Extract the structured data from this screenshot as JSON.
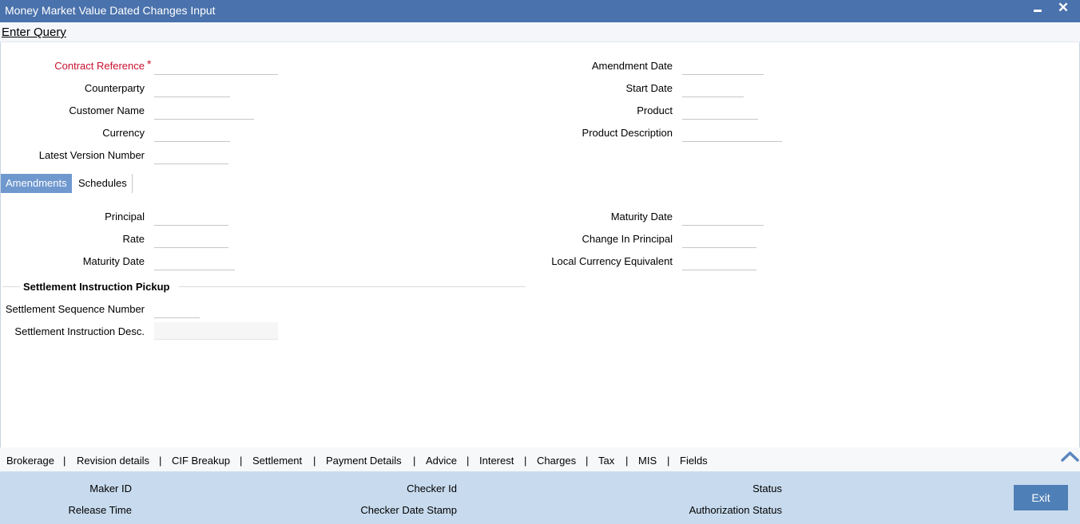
{
  "window": {
    "title": "Money Market Value Dated Changes Input"
  },
  "toolbar": {
    "enter_query": "Enter Query"
  },
  "header_fields": {
    "contract_reference": {
      "label": "Contract Reference",
      "required_mark": "*",
      "value": ""
    },
    "counterparty": {
      "label": "Counterparty",
      "value": ""
    },
    "customer_name": {
      "label": "Customer Name",
      "value": ""
    },
    "currency": {
      "label": "Currency",
      "value": ""
    },
    "latest_version_number": {
      "label": "Latest Version Number",
      "value": ""
    },
    "amendment_date": {
      "label": "Amendment Date",
      "value": ""
    },
    "start_date": {
      "label": "Start Date",
      "value": ""
    },
    "product": {
      "label": "Product",
      "value": ""
    },
    "product_description": {
      "label": "Product Description",
      "value": ""
    }
  },
  "tabs": [
    {
      "label": "Amendments",
      "active": true
    },
    {
      "label": "Schedules",
      "active": false
    }
  ],
  "amendments": {
    "principal": {
      "label": "Principal",
      "value": ""
    },
    "rate": {
      "label": "Rate",
      "value": ""
    },
    "maturity_date_left": {
      "label": "Maturity Date",
      "value": ""
    },
    "maturity_date_right": {
      "label": "Maturity Date",
      "value": ""
    },
    "change_in_principal": {
      "label": "Change In Principal",
      "value": ""
    },
    "local_currency_equivalent": {
      "label": "Local Currency Equivalent",
      "value": ""
    }
  },
  "settlement": {
    "section_title": "Settlement Instruction Pickup",
    "sequence_number": {
      "label": "Settlement Sequence Number",
      "value": ""
    },
    "instruction_desc": {
      "label": "Settlement Instruction Desc.",
      "value": ""
    }
  },
  "footer_links": [
    "Brokerage",
    "Revision details",
    "CIF Breakup",
    "Settlement",
    "Payment Details",
    "Advice",
    "Interest",
    "Charges",
    "Tax",
    "MIS",
    "Fields"
  ],
  "footer_separator": "|",
  "audit": {
    "maker_id": "Maker ID",
    "release_time": "Release Time",
    "checker_id": "Checker Id",
    "checker_date_stamp": "Checker Date Stamp",
    "status": "Status",
    "authorization_status": "Authorization Status",
    "exit_label": "Exit"
  },
  "colors": {
    "titlebar": "#4a72ac",
    "active_tab": "#6f98cf",
    "required": "#c8102e",
    "audit_bar": "#c8dbee",
    "exit_button": "#4e7fb6"
  },
  "icons": {
    "minimize": "minimize-icon",
    "close": "close-icon",
    "scroll_up": "chevron-up-icon"
  }
}
